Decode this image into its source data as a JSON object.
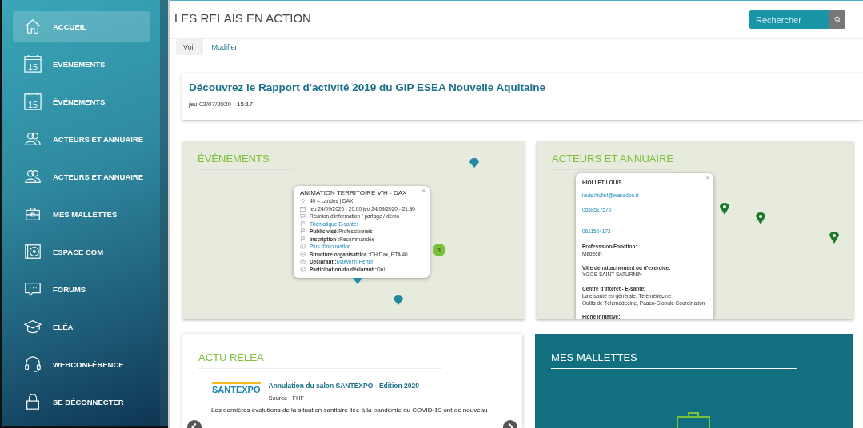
{
  "sidebar": {
    "items": [
      {
        "label": "ACCUEIL",
        "kind": "home",
        "selected": true
      },
      {
        "label": "ÉVÉNEMENTS",
        "kind": "calendar",
        "day": "15",
        "selected": false
      },
      {
        "label": "ÉVÉNEMENTS",
        "kind": "calendar",
        "day": "15",
        "selected": false
      },
      {
        "label": "ACTEURS ET ANNUAIRE",
        "kind": "people",
        "selected": false
      },
      {
        "label": "ACTEURS ET ANNUAIRE",
        "kind": "people",
        "selected": false
      },
      {
        "label": "MES MALLETTES",
        "kind": "briefcase",
        "selected": false
      },
      {
        "label": "ESPACE COM",
        "kind": "disc",
        "selected": false
      },
      {
        "label": "FORUMS",
        "kind": "chat",
        "selected": false
      },
      {
        "label": "ELÉA",
        "kind": "cap",
        "selected": false
      },
      {
        "label": "WEBCONFÉRENCE",
        "kind": "headset",
        "selected": false
      },
      {
        "label": "SE DÉCONNECTER",
        "kind": "lock",
        "selected": false
      }
    ]
  },
  "header": {
    "title": "LES RELAIS EN ACTION",
    "search": {
      "placeholder": "Rechercher"
    }
  },
  "tabs": [
    {
      "label": "Voir",
      "selected": true
    },
    {
      "label": "Modifier",
      "selected": false
    }
  ],
  "article": {
    "title": "Découvrez le Rapport d'activité 2019 du GIP ESEA Nouvelle Aquitaine",
    "date": "jeu 02/07/2020 - 15:17"
  },
  "event_map": {
    "title": "ÉVÉNEMENTS",
    "cluster_count": "3",
    "popup": {
      "close": "×",
      "title": "ANIMATION TERRITOIRE V/H - DAX",
      "rows": [
        {
          "kind": "pin",
          "value": "40 – Landes | DAX",
          "link": false
        },
        {
          "kind": "calendar",
          "value": "jeu 24/09/2020 - 20:00 jeu 24/09/2020 - 21:30",
          "link": false
        },
        {
          "kind": "chat",
          "value": "Réunion d'information / partage / démo",
          "link": false
        },
        {
          "kind": "flag",
          "value": "Thématique E-santé:",
          "link": true
        },
        {
          "kind": "flag",
          "label": "Public visé:",
          "value": "Professionnels",
          "link": false
        },
        {
          "kind": "flag",
          "label": "Inscription :",
          "value": "Recommandée",
          "link": false
        },
        {
          "kind": "info",
          "value": "Plus d'information",
          "link": true
        },
        {
          "kind": "building",
          "label": "Structure organisatrice :",
          "value": "CH Dax, PTA 40",
          "link": false
        },
        {
          "kind": "person",
          "label": "Déclarant :",
          "value": "Maiwenn Herter",
          "link": true
        },
        {
          "kind": "info",
          "label": "Participation du déclarant :",
          "value": "Oui",
          "link": false
        }
      ]
    }
  },
  "contact_map": {
    "title": "ACTEURS ET ANNUAIRE",
    "popup": {
      "close": "×",
      "name": "HIOLLET LOUIS",
      "links": [
        "louis.hiollet@wanadoo.fr",
        "0558517576",
        "0611564172"
      ],
      "sections": [
        {
          "label": "Professsion/Fonction:",
          "lines": [
            "Médecin"
          ]
        },
        {
          "label": "Ville de rattachement ou d'exercice:",
          "lines": [
            "YGOS-SAINT-SATURNIN"
          ]
        },
        {
          "label": "Centre d'intérêt - E-santé:",
          "lines": [
            "La e-santé en générale, Télémédecine",
            "Outils de Télémédecine, Paaco-Globule Coordination"
          ]
        },
        {
          "label": "Fiche initiative:"
        }
      ]
    }
  },
  "news": {
    "title": "ACTU RELEA",
    "item": {
      "logo": "SANTEXPO",
      "title": "Annulation du salon SANTEXPO - Edition 2020",
      "source": "Source : FHF",
      "excerpt": "Les dernières évolutions de la situation sanitaire liée à la pandémie du COVID-19 ont de nouveau"
    }
  },
  "mallettes": {
    "title": "MES MALLETTES"
  }
}
